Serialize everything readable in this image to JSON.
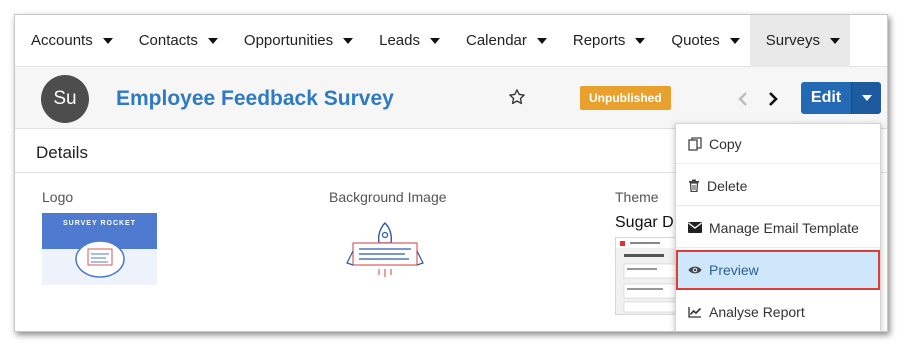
{
  "nav": {
    "items": [
      {
        "label": "Accounts",
        "icon": "caret-down-icon"
      },
      {
        "label": "Contacts",
        "icon": "caret-down-icon"
      },
      {
        "label": "Opportunities",
        "icon": "caret-down-icon"
      },
      {
        "label": "Leads",
        "icon": "caret-down-icon"
      },
      {
        "label": "Calendar",
        "icon": "caret-down-icon"
      },
      {
        "label": "Reports",
        "icon": "caret-down-icon"
      },
      {
        "label": "Quotes",
        "icon": "caret-down-icon"
      },
      {
        "label": "Surveys",
        "icon": "caret-down-icon",
        "active": true
      }
    ]
  },
  "record": {
    "avatar_initials": "Su",
    "title": "Employee Feedback Survey",
    "status_badge": "Unpublished",
    "status_color": "#e9a12d",
    "edit_label": "Edit",
    "accent_color": "#2469b3"
  },
  "details": {
    "heading": "Details",
    "logo_label": "Logo",
    "logo_image_text": "SURVEY ROCKET",
    "background_label": "Background Image",
    "theme_label": "Theme",
    "theme_value": "Sugar D"
  },
  "dropdown": {
    "items": [
      {
        "label": "Copy",
        "icon": "copy-icon"
      },
      {
        "label": "Delete",
        "icon": "trash-icon"
      },
      {
        "label": "Manage Email Template",
        "icon": "envelope-icon"
      },
      {
        "label": "Preview",
        "icon": "eye-icon",
        "highlighted": true
      },
      {
        "label": "Analyse Report",
        "icon": "line-chart-icon"
      }
    ]
  }
}
